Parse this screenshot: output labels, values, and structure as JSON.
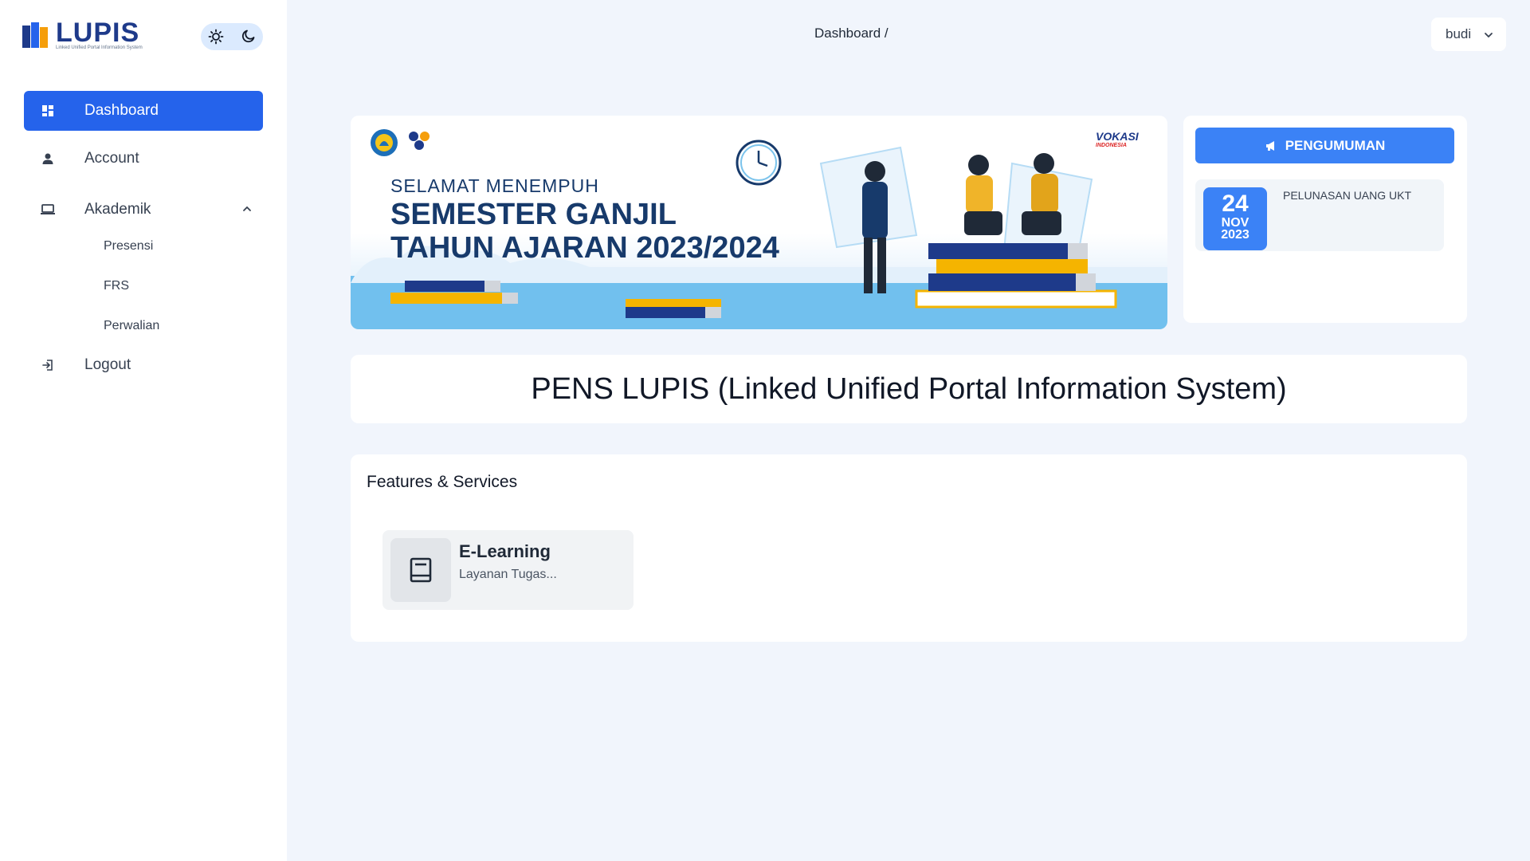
{
  "brand": {
    "name": "LUPIS",
    "subtitle": "Linked Unified Portal Information System"
  },
  "sidebar": {
    "items": [
      {
        "label": "Dashboard",
        "icon": "dashboard-icon",
        "active": true
      },
      {
        "label": "Account",
        "icon": "user-icon"
      },
      {
        "label": "Akademik",
        "icon": "laptop-icon",
        "expanded": true
      },
      {
        "label": "Logout",
        "icon": "logout-icon"
      }
    ],
    "sub_items": [
      "Presensi",
      "FRS",
      "Perwalian"
    ]
  },
  "header": {
    "breadcrumb": "Dashboard /",
    "user": "budi"
  },
  "banner": {
    "greeting": "SELAMAT MENEMPUH",
    "line1": "SEMESTER GANJIL",
    "line2": "TAHUN AJARAN 2023/2024",
    "vokasi": "VOKASI",
    "vokasi_sub": "INDONESIA"
  },
  "announcement": {
    "button_label": "PENGUMUMAN",
    "items": [
      {
        "day": "24",
        "month": "NOV",
        "year": "2023",
        "title": "PELUNASAN UANG UKT"
      }
    ]
  },
  "main": {
    "title": "PENS LUPIS (Linked Unified Portal Information System)",
    "features_heading": "Features & Services",
    "services": [
      {
        "title": "E-Learning",
        "desc": "Layanan Tugas..."
      }
    ]
  },
  "colors": {
    "primary": "#2563eb",
    "accent": "#3b82f6",
    "background": "#f1f5fc",
    "banner_navy": "#173a6b"
  }
}
